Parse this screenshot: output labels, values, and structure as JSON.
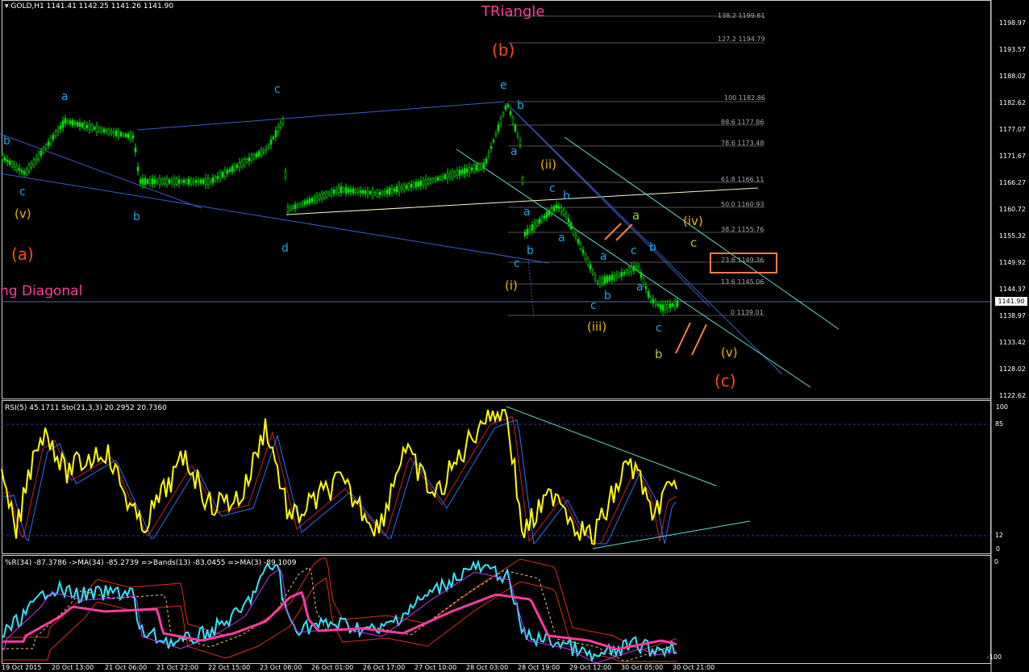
{
  "symbol_header": "GOLD,H1  1141.41 1142.25 1141.26 1141.90",
  "title_text": "TRiangle",
  "diagonal_text": "ng Diagonal",
  "current_price": "1141.90",
  "price_axis": [
    "1198.97",
    "1193.57",
    "1188.02",
    "1182.62",
    "1177.07",
    "1171.67",
    "1166.27",
    "1160.72",
    "1155.32",
    "1149.92",
    "1144.37",
    "1138.97",
    "1133.42",
    "1128.02",
    "1122.62"
  ],
  "fib_levels": [
    "138.2 1199.61",
    "127.2 1194.79",
    "100 1182.86",
    "88.6 1177.86",
    "78.6 1173.48",
    "61.8 1166.11",
    "50.0 1160.93",
    "38.2 1155.76",
    "23.6 1149.36",
    "13.6 1145.06",
    "0 1139.01"
  ],
  "wave_labels": {
    "b_left": "b",
    "c_left": "c",
    "v_left": "(v)",
    "a_left": "(a)",
    "a1": "a",
    "b1": "b",
    "c1": "c",
    "d1": "d",
    "e1": "e",
    "b_paren": "(b)",
    "b_e": "b",
    "a_e": "a",
    "ii": "(ii)",
    "a_down": "a",
    "c_low": "c",
    "b_low": "b",
    "i": "(i)",
    "c2": "c",
    "b2": "b",
    "a2": "a",
    "b3": "b",
    "a3": "a",
    "c3": "c",
    "iii": "(iii)",
    "a_olive": "a",
    "iv": "(iv)",
    "c_olive": "c",
    "b4": "b",
    "a4": "a",
    "c4": "c",
    "b_olive": "b",
    "v_right": "(v)",
    "c_paren": "(c)"
  },
  "rsi_header": "RSI(5) 45.1711  Sto(21,3,3) 20.2952 20.7360",
  "rsi_axis": [
    "100",
    "85",
    "12",
    "0"
  ],
  "wpr_header": "%R(34) -87.3786  ->MA(34) -85.2739  =>Bands(13) -83.0455  =>MA(3) -89.1009",
  "wpr_axis": [
    "0",
    "-100"
  ],
  "dates": [
    "19 Oct 2015",
    "20 Oct 13:00",
    "21 Oct 06:00",
    "21 Oct 22:00",
    "22 Oct 15:00",
    "23 Oct 08:00",
    "26 Oct 01:00",
    "26 Oct 17:00",
    "27 Oct 10:00",
    "28 Oct 03:00",
    "28 Oct 19:00",
    "29 Oct 12:00",
    "30 Oct 05:00",
    "30 Oct 21:00"
  ],
  "colors": {
    "candle": "#00e000",
    "trendline": "#3a5ccf",
    "channel": "#66ddcc",
    "rsi": "#ffff00",
    "wpr": "#33e5ff",
    "ma_pink": "#ff3ca0",
    "bands": "#e03010",
    "accent_box": "#ff8040"
  }
}
